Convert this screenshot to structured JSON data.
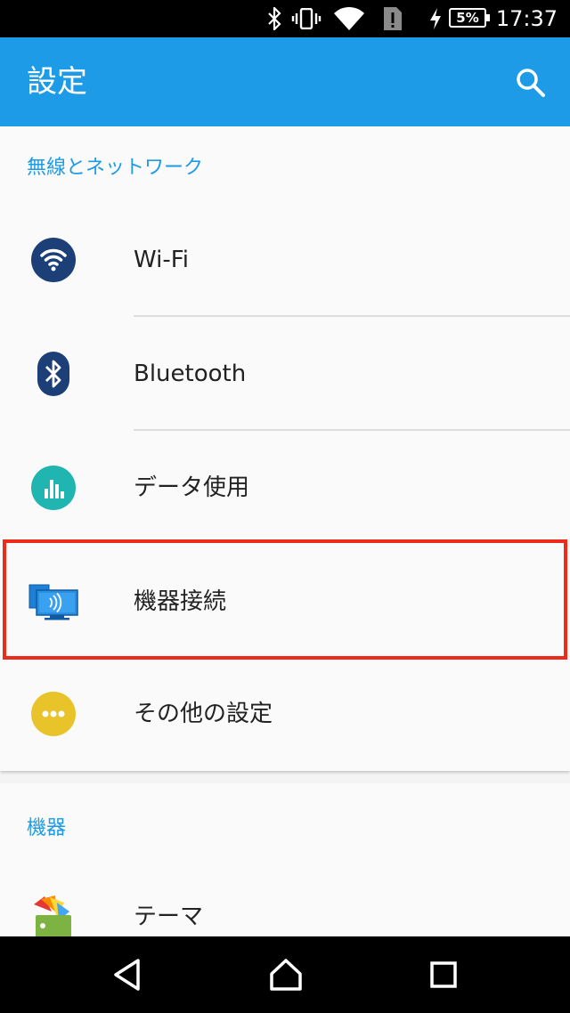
{
  "status_bar": {
    "time": "17:37",
    "battery_percent": "5%",
    "icons": [
      "bluetooth-icon",
      "vibrate-icon",
      "wifi-icon",
      "sim-alert-icon",
      "charging-icon",
      "battery-icon"
    ]
  },
  "app_bar": {
    "title": "設定",
    "search_icon": "search-icon"
  },
  "sections": [
    {
      "header": "無線とネットワーク",
      "items": [
        {
          "label": "Wi-Fi",
          "icon": "wifi-icon",
          "icon_color": "#1c3f77"
        },
        {
          "label": "Bluetooth",
          "icon": "bluetooth-icon",
          "icon_color": "#1c3f77"
        },
        {
          "label": "データ使用",
          "icon": "data-usage-icon",
          "icon_color": "#20b5b0"
        },
        {
          "label": "機器接続",
          "icon": "device-connection-icon",
          "icon_color": "#1d7fd6",
          "highlighted": true
        },
        {
          "label": "その他の設定",
          "icon": "more-icon",
          "icon_color": "#e8c32a"
        }
      ]
    },
    {
      "header": "機器",
      "items": [
        {
          "label": "テーマ",
          "icon": "theme-icon"
        }
      ]
    }
  ],
  "colors": {
    "accent": "#1d9be6",
    "highlight": "#ee2a1b"
  },
  "nav_bar": {
    "icons": [
      "back-icon",
      "home-icon",
      "recents-icon"
    ]
  }
}
